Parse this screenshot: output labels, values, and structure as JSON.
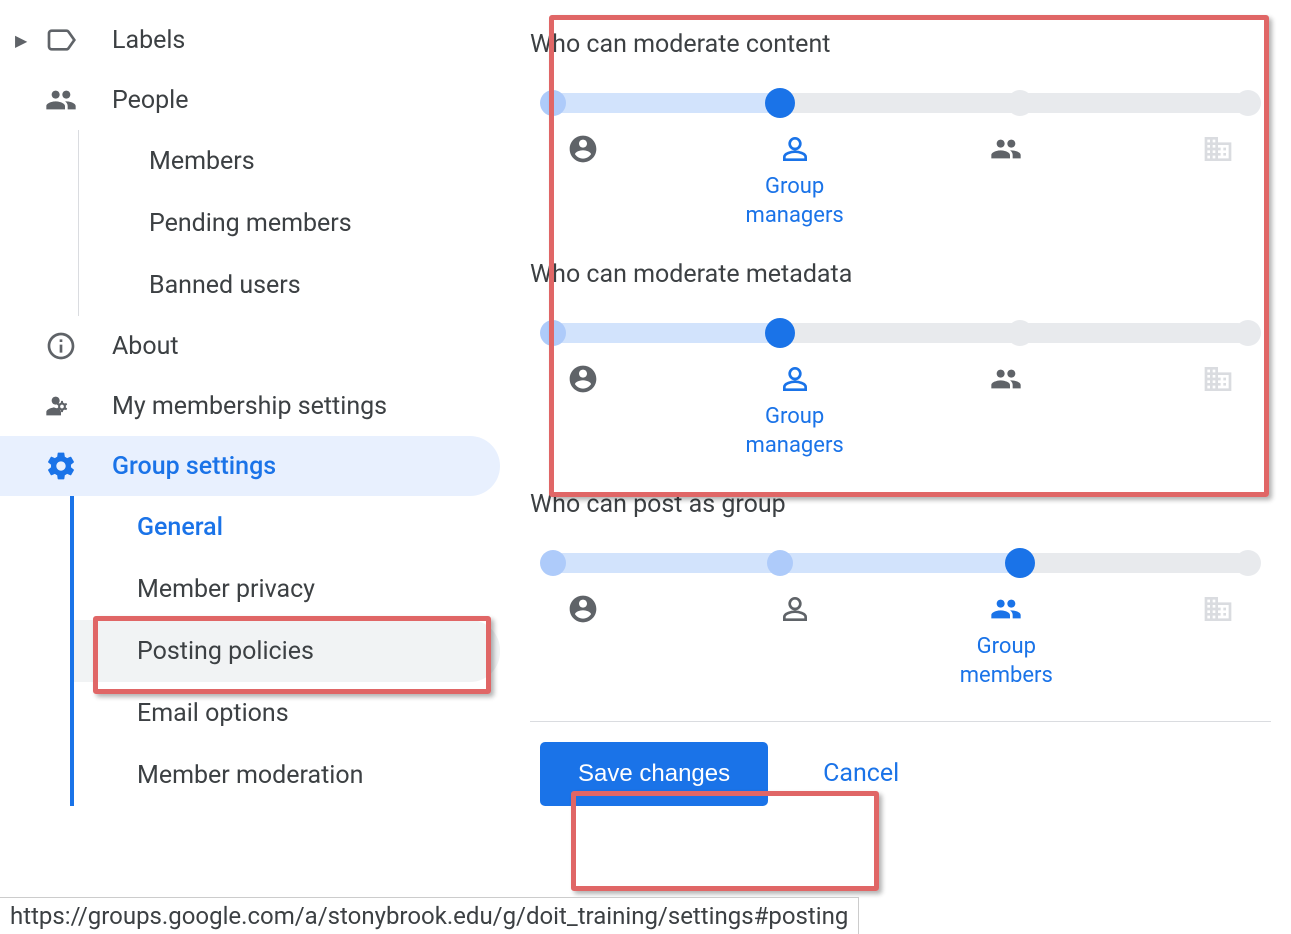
{
  "sidebar": {
    "labels_label": "Labels",
    "people_label": "People",
    "members_label": "Members",
    "pending_label": "Pending members",
    "banned_label": "Banned users",
    "about_label": "About",
    "membership_label": "My membership settings",
    "group_settings_label": "Group settings",
    "general_label": "General",
    "privacy_label": "Member privacy",
    "posting_label": "Posting policies",
    "email_label": "Email options",
    "moderation_label": "Member moderation"
  },
  "settings": {
    "moderate_content": {
      "title": "Who can moderate content",
      "selected_index": 1,
      "selected_label": "Group managers"
    },
    "moderate_metadata": {
      "title": "Who can moderate metadata",
      "selected_index": 1,
      "selected_label": "Group managers"
    },
    "post_as_group": {
      "title": "Who can post as group",
      "selected_index": 2,
      "selected_label": "Group members"
    }
  },
  "actions": {
    "save_label": "Save changes",
    "cancel_label": "Cancel"
  },
  "status_url": "https://groups.google.com/a/stonybrook.edu/g/doit_training/settings#posting"
}
